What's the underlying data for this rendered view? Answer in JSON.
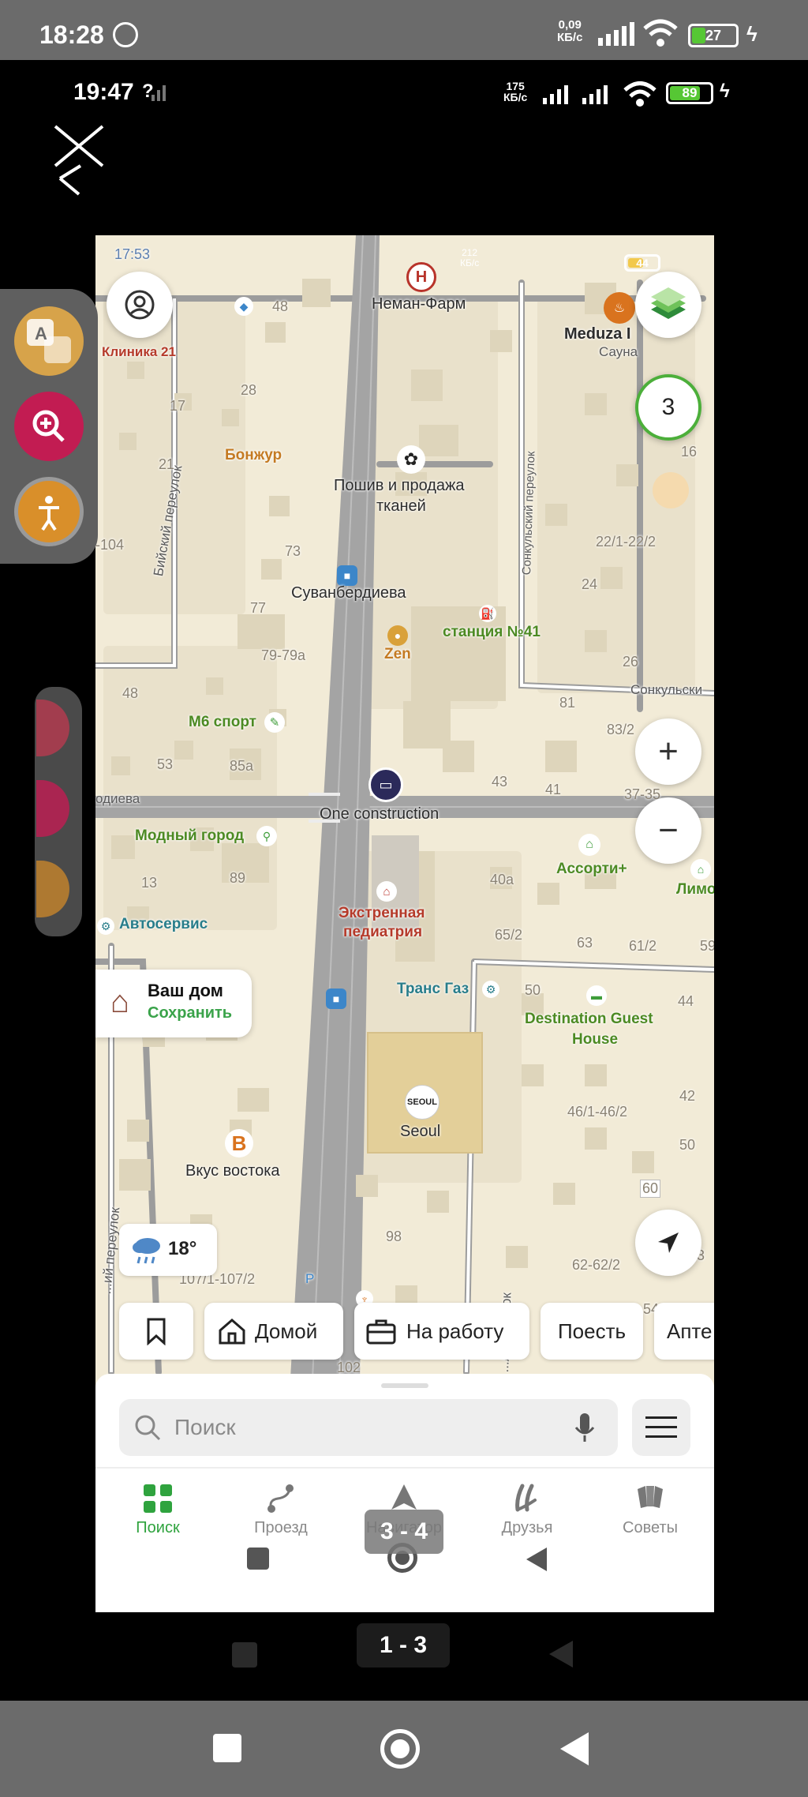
{
  "outer_status": {
    "time": "18:28",
    "speed_top": "0,09",
    "speed_unit": "КБ/с",
    "battery": "27"
  },
  "inner_status": {
    "time": "19:47",
    "signal_note": "?",
    "speed_top": "175",
    "speed_unit": "КБ/с",
    "battery": "89"
  },
  "map": {
    "map_status": {
      "time": "17:53",
      "speed_top": "212",
      "speed_unit": "КБ/с",
      "battery": "44"
    },
    "pois": {
      "neman": "Неман-Фарм",
      "meduza": "Meduza I",
      "meduza_sub": "Сауна",
      "klinika": "Клиника 21",
      "bonjour": "Бонжур",
      "poshiv_1": "Пошив и продажа",
      "poshiv_2": "тканей",
      "suvan": "Суванбердиева",
      "zen": "Zen",
      "station": "станция №41",
      "m6": "М6 спорт",
      "one_constr": "One construction",
      "modny": "Модный город",
      "assorti": "Ассорти+",
      "limo": "Лимо",
      "avtoservis": "Автосервис",
      "ekstr_1": "Экстренная",
      "ekstr_2": "педиатрия",
      "trans_gaz": "Транс Газ",
      "dest_1": "Destination Guest",
      "dest_2": "House",
      "seoul": "Seoul",
      "seoul_logo": "SEOUL",
      "vkus": "Вкус востока",
      "pin_r": "Р"
    },
    "streets": {
      "biysky": "Бийский переулок",
      "sonkulsky_lane": "Сонкульский переулок",
      "sonkulsky": "Сонкульски",
      "odieva": "одиева",
      "lane_left": "...ий переулок",
      "lane_bottom": "...л переулок"
    },
    "numbers": [
      "48",
      "28",
      "17",
      "21",
      "-104",
      "73",
      "77",
      "79-79а",
      "48",
      "53",
      "85а",
      "16",
      "22/1-22/2",
      "24",
      "26",
      "81",
      "83/2",
      "43",
      "41",
      "37-35",
      "13",
      "89",
      "40а",
      "65/2",
      "63",
      "61/2",
      "59",
      "50",
      "44",
      "42",
      "46/1-46/2",
      "50",
      "60",
      "98",
      "107/1-107/2",
      "62-62/2",
      "54",
      "102",
      "3"
    ],
    "badge_count": "3",
    "zoom_in": "+",
    "zoom_out": "−"
  },
  "home_card": {
    "title": "Ваш дом",
    "action": "Сохранить"
  },
  "weather": {
    "temp": "18°"
  },
  "chips": {
    "home": "Домой",
    "work": "На работу",
    "eat": "Поесть",
    "pharmacy": "Апте"
  },
  "search": {
    "placeholder": "Поиск"
  },
  "bottom_nav": [
    {
      "label": "Поиск",
      "active": true
    },
    {
      "label": "Проезд"
    },
    {
      "label": "Навигатор"
    },
    {
      "label": "Друзья"
    },
    {
      "label": "Советы"
    }
  ],
  "tags": {
    "inner": "3 - 4",
    "outer": "1 - 3"
  },
  "colors": {
    "accent_green": "#2fa33e",
    "map_bg": "#f2ebd7",
    "road": "#a4a4a4"
  }
}
